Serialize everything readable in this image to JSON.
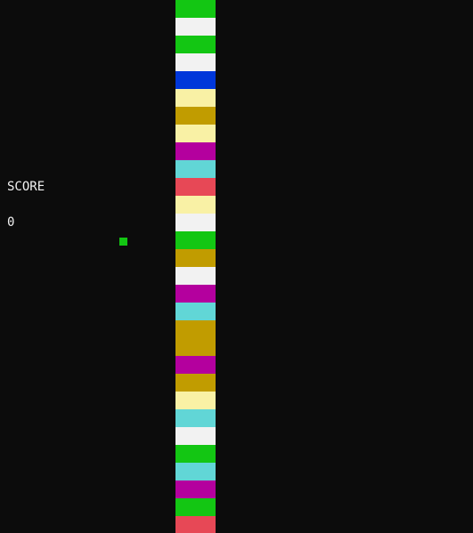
{
  "hud": {
    "score_label": "SCORE",
    "score_value": "0"
  },
  "colors": {
    "background": "#0c0c0c",
    "text": "#f2f2f2",
    "player": "#13c613"
  },
  "blocks": [
    {
      "color": "#13c613"
    },
    {
      "color": "#f2f2f2"
    },
    {
      "color": "#13c613"
    },
    {
      "color": "#f2f2f2"
    },
    {
      "color": "#0037da"
    },
    {
      "color": "#f9f1a5"
    },
    {
      "color": "#c19c00"
    },
    {
      "color": "#f9f1a5"
    },
    {
      "color": "#b4009e"
    },
    {
      "color": "#61d6d6"
    },
    {
      "color": "#e74856"
    },
    {
      "color": "#f9f1a5"
    },
    {
      "color": "#f2f2f2"
    },
    {
      "color": "#13c613"
    },
    {
      "color": "#c19c00"
    },
    {
      "color": "#f2f2f2"
    },
    {
      "color": "#b4009e"
    },
    {
      "color": "#61d6d6"
    },
    {
      "color": "#c19c00"
    },
    {
      "color": "#c19c00"
    },
    {
      "color": "#b4009e"
    },
    {
      "color": "#c19c00"
    },
    {
      "color": "#f9f1a5"
    },
    {
      "color": "#61d6d6"
    },
    {
      "color": "#f2f2f2"
    },
    {
      "color": "#13c613"
    },
    {
      "color": "#61d6d6"
    },
    {
      "color": "#b4009e"
    },
    {
      "color": "#13c613"
    },
    {
      "color": "#e74856"
    }
  ]
}
